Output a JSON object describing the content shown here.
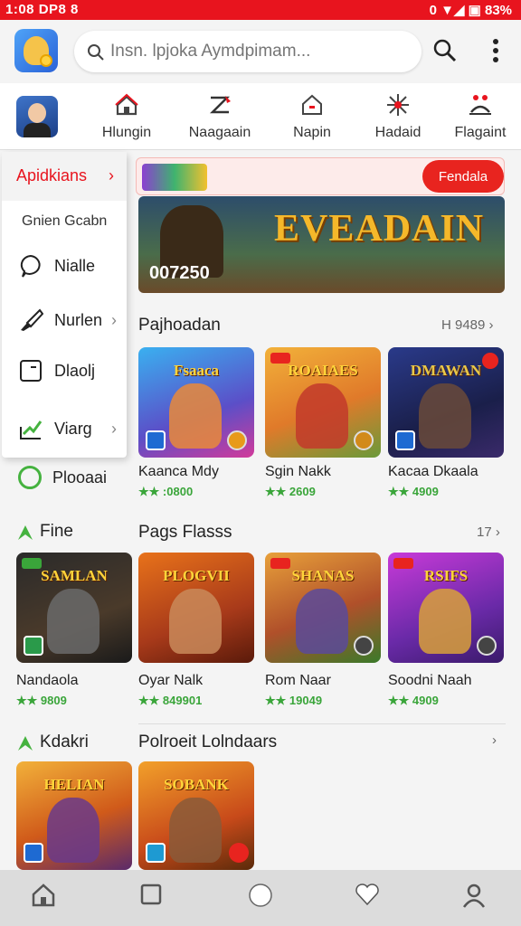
{
  "status_bar": {
    "time": "1:08 DP8 8",
    "right": "0 ▼◢ ▣ 83%"
  },
  "search": {
    "placeholder": "Insn. lpjoka Aymdpimam..."
  },
  "top_tabs": [
    {
      "label": "Hlungin",
      "icon": "home-icon"
    },
    {
      "label": "Naagaain",
      "icon": "ticket-icon"
    },
    {
      "label": "Napin",
      "icon": "house-outline-icon"
    },
    {
      "label": "Hadaid",
      "icon": "sparkle-icon"
    },
    {
      "label": "Flagaint",
      "icon": "people-icon"
    }
  ],
  "drawer": {
    "header": "Apidkians",
    "subheader": "Gnien Gcabn",
    "items": [
      {
        "label": "Nialle",
        "icon": "chat-bubble-icon",
        "chevron": false
      },
      {
        "label": "Nurlen",
        "icon": "brush-icon",
        "chevron": true
      },
      {
        "label": "Dlaolj",
        "icon": "document-icon",
        "chevron": false
      },
      {
        "label": "Viarg",
        "icon": "chart-up-icon",
        "chevron": true
      }
    ]
  },
  "side_item": {
    "label": "Plooaai"
  },
  "promo": {
    "button": "Fendala"
  },
  "hero": {
    "title": "EVEADAIN",
    "code": "007250"
  },
  "sections": [
    {
      "title": "Pajhoadan",
      "more": "H 9489 ›",
      "games": [
        {
          "art": "Fsaaca",
          "name": "Kaanca Mdy",
          "rating": "★★ :0800"
        },
        {
          "art": "ROAIAES",
          "name": "Sgin Nakk",
          "rating": "★★ 2609"
        },
        {
          "art": "DMAWAN",
          "name": "Kacaa Dkaala",
          "rating": "★★ 4909"
        }
      ]
    },
    {
      "title": "Pags Flasss",
      "more": "17 ›",
      "games": [
        {
          "art": "SAMLAN",
          "name": "Nandaola",
          "rating": "★★ 9809"
        },
        {
          "art": "PLOGVII",
          "name": "Oyar Nalk",
          "rating": "★★ 849901"
        },
        {
          "art": "SHANAS",
          "name": "Rom Naar",
          "rating": "★★ 19049"
        },
        {
          "art": "RSIFS",
          "name": "Soodni Naah",
          "rating": "★★ 4909"
        }
      ]
    },
    {
      "title": "Polroeit Lolndaars",
      "more": "›",
      "games": [
        {
          "art": "HELIAN"
        },
        {
          "art": "SOBANK"
        }
      ]
    }
  ],
  "side_labels": {
    "fine": "Fine",
    "kdakri": "Kdakri"
  },
  "colors": {
    "accent": "#e8141e",
    "rating": "#3aa53a"
  },
  "bottom_nav": [
    "home-icon",
    "square-icon",
    "circle-icon",
    "heart-icon",
    "profile-icon"
  ]
}
